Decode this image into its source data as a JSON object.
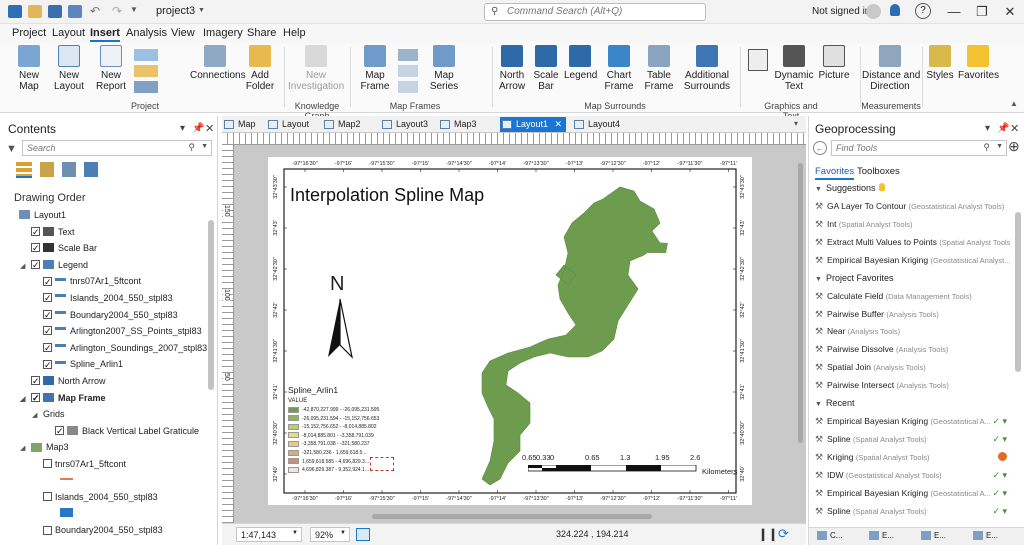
{
  "title_bar": {
    "project_name": "project3",
    "search_placeholder": "Command Search (Alt+Q)",
    "sign_in": "Not signed in"
  },
  "menu": [
    "Project",
    "Layout",
    "Insert",
    "Analysis",
    "View",
    "Imagery",
    "Share",
    "Help"
  ],
  "menu_active": "Insert",
  "ribbon": {
    "buttons": [
      {
        "label": "New\nMap",
        "icon": "new-map-icon"
      },
      {
        "label": "New\nLayout",
        "icon": "new-layout-icon"
      },
      {
        "label": "New\nReport",
        "icon": "new-report-icon"
      },
      {
        "label": "Connections",
        "icon": "connections-icon"
      },
      {
        "label": "Add\nFolder",
        "icon": "add-folder-icon"
      },
      {
        "label": "New\nInvestigation",
        "icon": "investigation-icon",
        "disabled": true
      },
      {
        "label": "Map\nFrame",
        "icon": "map-frame-icon"
      },
      {
        "label": "Map\nSeries",
        "icon": "map-series-icon"
      },
      {
        "label": "North\nArrow",
        "icon": "north-arrow-icon"
      },
      {
        "label": "Scale\nBar",
        "icon": "scale-bar-icon"
      },
      {
        "label": "Legend",
        "icon": "legend-icon"
      },
      {
        "label": "Chart\nFrame",
        "icon": "chart-frame-icon"
      },
      {
        "label": "Table\nFrame",
        "icon": "table-frame-icon"
      },
      {
        "label": "Additional\nSurrounds",
        "icon": "additional-surrounds-icon"
      },
      {
        "label": "Dynamic\nText",
        "icon": "dynamic-text-icon"
      },
      {
        "label": "Picture",
        "icon": "picture-icon"
      },
      {
        "label": "Distance and\nDirection",
        "icon": "distance-direction-icon"
      },
      {
        "label": "Styles",
        "icon": "styles-icon"
      },
      {
        "label": "Favorites",
        "icon": "favorites-icon"
      }
    ],
    "groups": [
      "Project",
      "Knowledge Graph",
      "Map Frames",
      "Map Surrounds",
      "Graphics and Text",
      "Measurements"
    ]
  },
  "contents": {
    "title": "Contents",
    "search_placeholder": "Search",
    "drawing_order": "Drawing Order",
    "tree": [
      {
        "label": "Layout1",
        "level": 0,
        "checkbox": false,
        "icon": "layout"
      },
      {
        "label": "Text",
        "level": 1,
        "checkbox": true,
        "checked": true,
        "icon": "text"
      },
      {
        "label": "Scale Bar",
        "level": 1,
        "checkbox": true,
        "checked": true,
        "icon": "scalebar"
      },
      {
        "label": "Legend",
        "level": 1,
        "checkbox": true,
        "checked": true,
        "icon": "legend",
        "expanded": true
      },
      {
        "label": "tnrs07Ar1_5ftcont",
        "level": 2,
        "checkbox": true,
        "checked": true,
        "icon": "legenditem"
      },
      {
        "label": "Islands_2004_550_stpl83",
        "level": 2,
        "checkbox": true,
        "checked": true,
        "icon": "legenditem"
      },
      {
        "label": "Boundary2004_550_stpl83",
        "level": 2,
        "checkbox": true,
        "checked": true,
        "icon": "legenditem"
      },
      {
        "label": "Arlington2007_SS_Points_stpl83",
        "level": 2,
        "checkbox": true,
        "checked": true,
        "icon": "legenditem"
      },
      {
        "label": "Arlington_Soundings_2007_stpl83",
        "level": 2,
        "checkbox": true,
        "checked": true,
        "icon": "legenditem"
      },
      {
        "label": "Spline_Arlin1",
        "level": 2,
        "checkbox": true,
        "checked": true,
        "icon": "legenditem"
      },
      {
        "label": "North Arrow",
        "level": 1,
        "checkbox": true,
        "checked": true,
        "icon": "northarrow"
      },
      {
        "label": "Map Frame",
        "level": 1,
        "checkbox": true,
        "checked": true,
        "icon": "mapframe",
        "bold": true,
        "expanded": true
      },
      {
        "label": "Grids",
        "level": 2,
        "checkbox": false,
        "icon": "none",
        "expanded": true
      },
      {
        "label": "Black Vertical Label Graticule",
        "level": 3,
        "checkbox": true,
        "checked": true,
        "icon": "graticule"
      },
      {
        "label": "Map3",
        "level": 1,
        "checkbox": false,
        "icon": "map",
        "expanded": true
      },
      {
        "label": "tnrs07Ar1_5ftcont",
        "level": 2,
        "checkbox": true,
        "checked": false,
        "icon": "none",
        "swatch": "line-orange"
      },
      {
        "label": "Islands_2004_550_stpl83",
        "level": 2,
        "checkbox": true,
        "checked": false,
        "icon": "none",
        "swatch": "fill-blue"
      },
      {
        "label": "Boundary2004_550_stpl83",
        "level": 2,
        "checkbox": true,
        "checked": false,
        "icon": "none"
      }
    ]
  },
  "doc_tabs": [
    "Map",
    "Layout",
    "Map2",
    "Layout3",
    "Map3",
    "Layout1",
    "Layout4"
  ],
  "doc_tab_active": "Layout1",
  "layout": {
    "map_title": "Interpolation Spline Map",
    "north_label": "N",
    "top_graticule": [
      "-97°16'30\"",
      "-97°16'",
      "-97°15'30\"",
      "-97°15'",
      "-97°14'30\"",
      "-97°14'",
      "-97°13'30\"",
      "-97°13'",
      "-97°12'30\"",
      "-97°12'",
      "-97°11'30\"",
      "-97°11'"
    ],
    "bottom_graticule": [
      "-97°16'30\"",
      "-97°16'",
      "-97°15'30\"",
      "-97°15'",
      "-97°14'30\"",
      "-97°14'",
      "-97°13'30\"",
      "-97°13'",
      "-97°12'30\"",
      "-97°12'",
      "-97°11'30\"",
      "-97°11'"
    ],
    "left_graticule": [
      "32°43'30\"",
      "32°43'",
      "32°42'30\"",
      "32°42'",
      "32°41'30\"",
      "32°41'",
      "32°40'30\"",
      "32°40'"
    ],
    "right_graticule": [
      "32°43'30\"",
      "32°43'",
      "32°42'30\"",
      "32°42'",
      "32°41'30\"",
      "32°41'",
      "32°40'30\"",
      "32°40'"
    ],
    "legend": {
      "title": "Spline_Arlin1",
      "field": "VALUE",
      "classes": [
        {
          "label": "-42,870,227.999 - -26,095,231.595",
          "color": "#6e9c4f"
        },
        {
          "label": "-26,095,231.594 - -15,152,756.653",
          "color": "#8fb45e"
        },
        {
          "label": "-15,152,756.652 - -8,014,885.802",
          "color": "#b9cf72"
        },
        {
          "label": "-8,014,885.801 - -3,358,791.039",
          "color": "#e3db86"
        },
        {
          "label": "-3,358,791.038 - -321,580.237",
          "color": "#ecc98a"
        },
        {
          "label": "-321,580.236 - 1,659,618.5...",
          "color": "#dca985"
        },
        {
          "label": "1,659,618.585 - 4,696,829.3...",
          "color": "#c98f78"
        },
        {
          "label": "4,696,829.387 - 9,352,924.1...",
          "color": "#f0e6dc"
        }
      ]
    },
    "scale_bar": {
      "ticks": [
        "0.65",
        "0.33",
        "0",
        "0.65",
        "1.3",
        "1.95",
        "2.6"
      ],
      "units": "Kilometers"
    },
    "vertical_ruler": [
      "150",
      "100",
      "50"
    ]
  },
  "status": {
    "scale": "1:47,143",
    "zoom": "92%",
    "coordinates": "324.224 , 194.214"
  },
  "geoprocessing": {
    "title": "Geoprocessing",
    "search_placeholder": "Find Tools",
    "tabs": [
      "Favorites",
      "Toolboxes"
    ],
    "active_tab": "Favorites",
    "suggestions_label": "Suggestions",
    "suggestions": [
      {
        "name": "GA Layer To Contour",
        "box": "(Geostatistical Analyst Tools)"
      },
      {
        "name": "Int",
        "box": "(Spatial Analyst Tools)"
      },
      {
        "name": "Extract Multi Values to Points",
        "box": "(Spatial Analyst Tools)"
      },
      {
        "name": "Empirical Bayesian Kriging",
        "box": "(Geostatistical Analyst..."
      }
    ],
    "favorites_label": "Project Favorites",
    "favorites": [
      {
        "name": "Calculate Field",
        "box": "(Data Management Tools)"
      },
      {
        "name": "Pairwise Buffer",
        "box": "(Analysis Tools)"
      },
      {
        "name": "Near",
        "box": "(Analysis Tools)"
      },
      {
        "name": "Pairwise Dissolve",
        "box": "(Analysis Tools)"
      },
      {
        "name": "Spatial Join",
        "box": "(Analysis Tools)"
      },
      {
        "name": "Pairwise Intersect",
        "box": "(Analysis Tools)"
      }
    ],
    "recent_label": "Recent",
    "recent": [
      {
        "name": "Empirical Bayesian Kriging",
        "box": "(Geostatistical A...",
        "status": "ok"
      },
      {
        "name": "Spline",
        "box": "(Spatial Analyst Tools)",
        "status": "ok"
      },
      {
        "name": "Kriging",
        "box": "(Spatial Analyst Tools)",
        "status": "warn"
      },
      {
        "name": "IDW",
        "box": "(Geostatistical Analyst Tools)",
        "status": "ok"
      },
      {
        "name": "Empirical Bayesian Kriging",
        "box": "(Geostatistical A...",
        "status": "ok"
      },
      {
        "name": "Spline",
        "box": "(Spatial Analyst Tools)",
        "status": "ok"
      }
    ],
    "bottom_tabs": [
      "C...",
      "E...",
      "E...",
      "E..."
    ]
  },
  "colors": {
    "accent": "#1976d2",
    "map_green": "#6e9c4f"
  }
}
